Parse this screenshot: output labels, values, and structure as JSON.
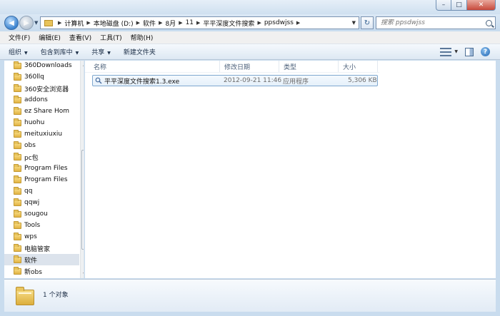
{
  "window": {
    "minimize_icon": "minimize-icon",
    "maximize_icon": "maximize-icon",
    "close_icon": "close-icon",
    "min_glyph": "–",
    "max_glyph": "□",
    "close_glyph": "✕"
  },
  "address": {
    "back_glyph": "◀",
    "forward_glyph": "▶",
    "crumbs": [
      "计算机",
      "本地磁盘 (D:)",
      "软件",
      "8月",
      "11",
      "平平深度文件搜索",
      "ppsdwjss"
    ],
    "refresh_glyph": "↻"
  },
  "search": {
    "placeholder": "搜索 ppsdwjss"
  },
  "menu": [
    "文件(F)",
    "编辑(E)",
    "查看(V)",
    "工具(T)",
    "帮助(H)"
  ],
  "commands": [
    "组织",
    "包含到库中",
    "共享",
    "新建文件夹"
  ],
  "columns": {
    "name": "名称",
    "date": "修改日期",
    "type": "类型",
    "size": "大小"
  },
  "files": [
    {
      "name": "平平深度文件搜索1.3.exe",
      "date": "2012-09-21 11:46",
      "type": "应用程序",
      "size": "5,306 KB"
    }
  ],
  "nav_folders": [
    "360Downloads",
    "360llq",
    "360安全浏览器",
    "addons",
    "ez Share Hom",
    "huohu",
    "meituxiuxiu",
    "obs",
    "pc包",
    "Program Files",
    "Program Files",
    "qq",
    "qqwj",
    "sougou",
    "Tools",
    "wps",
    "电脑管家",
    "软件",
    "新obs"
  ],
  "nav_selected": "软件",
  "status": {
    "count": "1 个对象"
  },
  "colors": {
    "accent": "#3b83cf",
    "selection": "#dce3ec",
    "folder": "#e2b443"
  }
}
